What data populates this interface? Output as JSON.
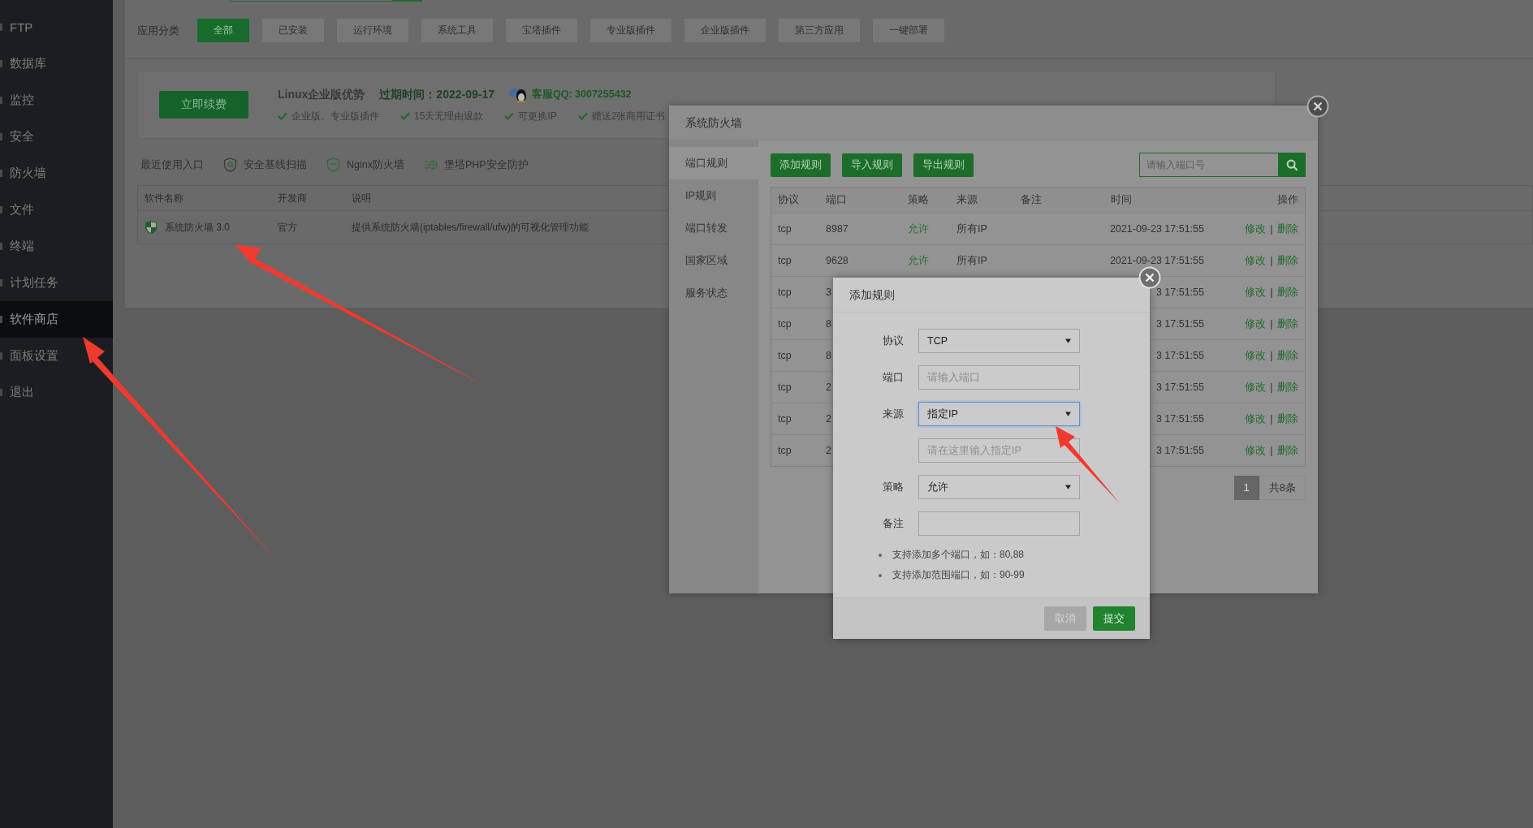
{
  "sidebar": {
    "items": [
      {
        "label": "FTP",
        "selected": false
      },
      {
        "label": "数据库",
        "selected": false
      },
      {
        "label": "监控",
        "selected": false
      },
      {
        "label": "安全",
        "selected": false
      },
      {
        "label": "防火墙",
        "selected": false
      },
      {
        "label": "文件",
        "selected": false
      },
      {
        "label": "终端",
        "selected": false
      },
      {
        "label": "计划任务",
        "selected": false
      },
      {
        "label": "软件商店",
        "selected": true
      },
      {
        "label": "面板设置",
        "selected": false
      },
      {
        "label": "退出",
        "selected": false
      }
    ]
  },
  "category_bar": {
    "label": "应用分类",
    "categories": [
      {
        "label": "全部",
        "selected": true
      },
      {
        "label": "已安装",
        "selected": false
      },
      {
        "label": "运行环境",
        "selected": false
      },
      {
        "label": "系统工具",
        "selected": false
      },
      {
        "label": "宝塔插件",
        "selected": false
      },
      {
        "label": "专业版插件",
        "selected": false
      },
      {
        "label": "企业版插件",
        "selected": false
      },
      {
        "label": "第三方应用",
        "selected": false
      },
      {
        "label": "一键部署",
        "selected": false
      }
    ]
  },
  "promo": {
    "button": "立即续费",
    "title": "Linux企业版优势",
    "expiry": "过期时间：2022-09-17",
    "support": "客服QQ: 3007255432",
    "benefits": [
      "企业版、专业版插件",
      "15天无理由退款",
      "可更换IP",
      "赠送2张商用证书"
    ]
  },
  "recent": {
    "label": "最近使用入口",
    "entries": [
      {
        "label": "安全基线扫描",
        "kind": "scan"
      },
      {
        "label": "Nginx防火墙",
        "kind": "waf"
      },
      {
        "label": "堡塔PHP安全防护",
        "kind": "php"
      }
    ]
  },
  "software_table": {
    "columns": [
      "软件名称",
      "开发商",
      "说明"
    ],
    "rows": [
      {
        "name": "系统防火墙 3.0",
        "developer": "官方",
        "description": "提供系统防火墙(iptables/firewall/ufw)的可视化管理功能"
      }
    ]
  },
  "firewall_dialog": {
    "title": "系统防火墙",
    "tabs": [
      {
        "label": "端口规则",
        "selected": true
      },
      {
        "label": "IP规则",
        "selected": false
      },
      {
        "label": "端口转发",
        "selected": false
      },
      {
        "label": "国家区域",
        "selected": false
      },
      {
        "label": "服务状态",
        "selected": false
      }
    ],
    "actions": [
      "添加规则",
      "导入规则",
      "导出规则"
    ],
    "search": {
      "placeholder": "请输入端口号"
    },
    "columns": [
      "协议",
      "端口",
      "策略",
      "来源",
      "备注",
      "时间",
      "操作"
    ],
    "rows": [
      {
        "protocol": "tcp",
        "port": "8987",
        "policy": "允许",
        "source": "所有IP",
        "time": "2021-09-23 17:51:55",
        "edit": "修改",
        "separator": "|",
        "delete": "删除"
      },
      {
        "protocol": "tcp",
        "port": "9628",
        "policy": "允许",
        "source": "所有IP",
        "time": "2021-09-23 17:51:55",
        "edit": "修改",
        "separator": "|",
        "delete": "删除"
      },
      {
        "protocol": "tcp",
        "port": "3",
        "time": "3 17:51:55",
        "edit": "修改",
        "separator": "|",
        "delete": "删除"
      },
      {
        "protocol": "tcp",
        "port": "8",
        "time": "3 17:51:55",
        "edit": "修改",
        "separator": "|",
        "delete": "删除"
      },
      {
        "protocol": "tcp",
        "port": "8",
        "time": "3 17:51:55",
        "edit": "修改",
        "separator": "|",
        "delete": "删除"
      },
      {
        "protocol": "tcp",
        "port": "2",
        "time": "3 17:51:55",
        "edit": "修改",
        "separator": "|",
        "delete": "删除"
      },
      {
        "protocol": "tcp",
        "port": "2",
        "time": "3 17:51:55",
        "edit": "修改",
        "separator": "|",
        "delete": "删除"
      },
      {
        "protocol": "tcp",
        "port": "2",
        "time": "3 17:51:55",
        "edit": "修改",
        "separator": "|",
        "delete": "删除"
      }
    ],
    "pagination": {
      "pages": [
        {
          "label": "1",
          "selected": true
        }
      ],
      "total": "共8条"
    }
  },
  "add_rule_dialog": {
    "title": "添加规则",
    "fields": [
      {
        "label": "协议",
        "kind": "select",
        "value": "TCP",
        "focused": false
      },
      {
        "label": "端口",
        "kind": "input",
        "placeholder": "请输入端口",
        "focused": false
      },
      {
        "label": "来源",
        "kind": "select",
        "value": "指定IP",
        "focused": true
      },
      {
        "kind": "input",
        "placeholder": "请在这里输入指定IP",
        "focused": false
      },
      {
        "label": "策略",
        "kind": "select",
        "value": "允许",
        "focused": false
      },
      {
        "label": "备注",
        "kind": "input",
        "focused": false
      }
    ],
    "notes": [
      "支持添加多个端口，如：80,88",
      "支持添加范围端口，如：90-99"
    ],
    "buttons": [
      {
        "label": "取消",
        "kind": "cancel"
      },
      {
        "label": "提交",
        "kind": "submit"
      }
    ]
  }
}
